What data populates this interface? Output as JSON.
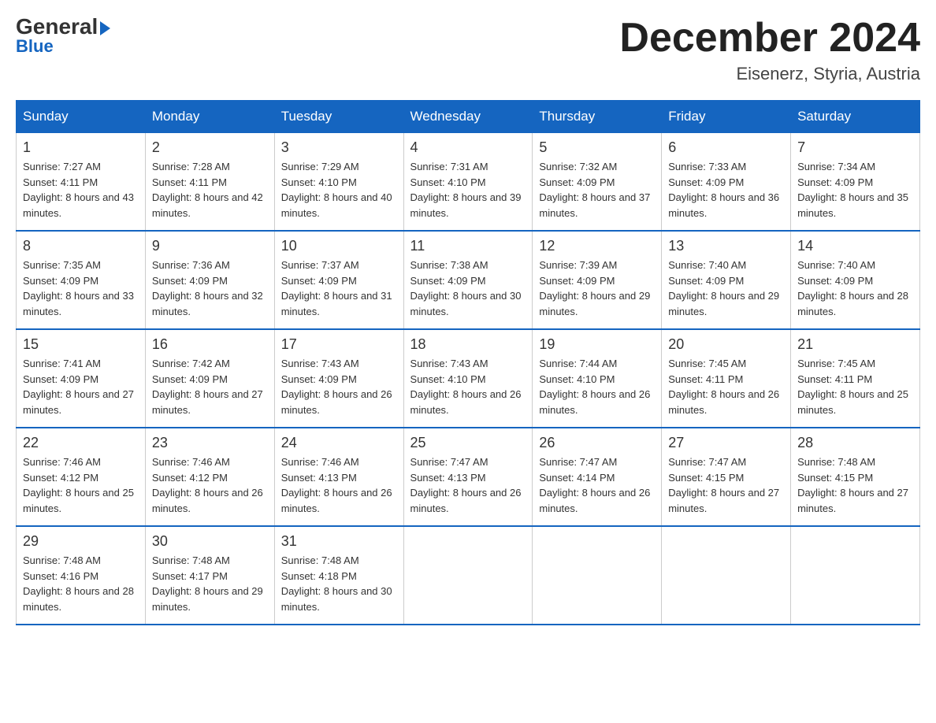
{
  "header": {
    "logo_general": "General",
    "logo_blue": "Blue",
    "month_title": "December 2024",
    "location": "Eisenerz, Styria, Austria"
  },
  "days_of_week": [
    "Sunday",
    "Monday",
    "Tuesday",
    "Wednesday",
    "Thursday",
    "Friday",
    "Saturday"
  ],
  "weeks": [
    [
      {
        "day": "1",
        "sunrise": "7:27 AM",
        "sunset": "4:11 PM",
        "daylight": "8 hours and 43 minutes."
      },
      {
        "day": "2",
        "sunrise": "7:28 AM",
        "sunset": "4:11 PM",
        "daylight": "8 hours and 42 minutes."
      },
      {
        "day": "3",
        "sunrise": "7:29 AM",
        "sunset": "4:10 PM",
        "daylight": "8 hours and 40 minutes."
      },
      {
        "day": "4",
        "sunrise": "7:31 AM",
        "sunset": "4:10 PM",
        "daylight": "8 hours and 39 minutes."
      },
      {
        "day": "5",
        "sunrise": "7:32 AM",
        "sunset": "4:09 PM",
        "daylight": "8 hours and 37 minutes."
      },
      {
        "day": "6",
        "sunrise": "7:33 AM",
        "sunset": "4:09 PM",
        "daylight": "8 hours and 36 minutes."
      },
      {
        "day": "7",
        "sunrise": "7:34 AM",
        "sunset": "4:09 PM",
        "daylight": "8 hours and 35 minutes."
      }
    ],
    [
      {
        "day": "8",
        "sunrise": "7:35 AM",
        "sunset": "4:09 PM",
        "daylight": "8 hours and 33 minutes."
      },
      {
        "day": "9",
        "sunrise": "7:36 AM",
        "sunset": "4:09 PM",
        "daylight": "8 hours and 32 minutes."
      },
      {
        "day": "10",
        "sunrise": "7:37 AM",
        "sunset": "4:09 PM",
        "daylight": "8 hours and 31 minutes."
      },
      {
        "day": "11",
        "sunrise": "7:38 AM",
        "sunset": "4:09 PM",
        "daylight": "8 hours and 30 minutes."
      },
      {
        "day": "12",
        "sunrise": "7:39 AM",
        "sunset": "4:09 PM",
        "daylight": "8 hours and 29 minutes."
      },
      {
        "day": "13",
        "sunrise": "7:40 AM",
        "sunset": "4:09 PM",
        "daylight": "8 hours and 29 minutes."
      },
      {
        "day": "14",
        "sunrise": "7:40 AM",
        "sunset": "4:09 PM",
        "daylight": "8 hours and 28 minutes."
      }
    ],
    [
      {
        "day": "15",
        "sunrise": "7:41 AM",
        "sunset": "4:09 PM",
        "daylight": "8 hours and 27 minutes."
      },
      {
        "day": "16",
        "sunrise": "7:42 AM",
        "sunset": "4:09 PM",
        "daylight": "8 hours and 27 minutes."
      },
      {
        "day": "17",
        "sunrise": "7:43 AM",
        "sunset": "4:09 PM",
        "daylight": "8 hours and 26 minutes."
      },
      {
        "day": "18",
        "sunrise": "7:43 AM",
        "sunset": "4:10 PM",
        "daylight": "8 hours and 26 minutes."
      },
      {
        "day": "19",
        "sunrise": "7:44 AM",
        "sunset": "4:10 PM",
        "daylight": "8 hours and 26 minutes."
      },
      {
        "day": "20",
        "sunrise": "7:45 AM",
        "sunset": "4:11 PM",
        "daylight": "8 hours and 26 minutes."
      },
      {
        "day": "21",
        "sunrise": "7:45 AM",
        "sunset": "4:11 PM",
        "daylight": "8 hours and 25 minutes."
      }
    ],
    [
      {
        "day": "22",
        "sunrise": "7:46 AM",
        "sunset": "4:12 PM",
        "daylight": "8 hours and 25 minutes."
      },
      {
        "day": "23",
        "sunrise": "7:46 AM",
        "sunset": "4:12 PM",
        "daylight": "8 hours and 26 minutes."
      },
      {
        "day": "24",
        "sunrise": "7:46 AM",
        "sunset": "4:13 PM",
        "daylight": "8 hours and 26 minutes."
      },
      {
        "day": "25",
        "sunrise": "7:47 AM",
        "sunset": "4:13 PM",
        "daylight": "8 hours and 26 minutes."
      },
      {
        "day": "26",
        "sunrise": "7:47 AM",
        "sunset": "4:14 PM",
        "daylight": "8 hours and 26 minutes."
      },
      {
        "day": "27",
        "sunrise": "7:47 AM",
        "sunset": "4:15 PM",
        "daylight": "8 hours and 27 minutes."
      },
      {
        "day": "28",
        "sunrise": "7:48 AM",
        "sunset": "4:15 PM",
        "daylight": "8 hours and 27 minutes."
      }
    ],
    [
      {
        "day": "29",
        "sunrise": "7:48 AM",
        "sunset": "4:16 PM",
        "daylight": "8 hours and 28 minutes."
      },
      {
        "day": "30",
        "sunrise": "7:48 AM",
        "sunset": "4:17 PM",
        "daylight": "8 hours and 29 minutes."
      },
      {
        "day": "31",
        "sunrise": "7:48 AM",
        "sunset": "4:18 PM",
        "daylight": "8 hours and 30 minutes."
      },
      null,
      null,
      null,
      null
    ]
  ]
}
